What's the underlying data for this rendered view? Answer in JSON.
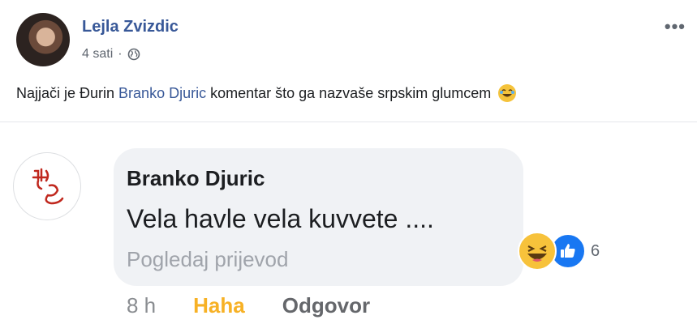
{
  "post": {
    "author": "Lejla Zvizdic",
    "time": "4 sati",
    "text_before": "Najjači je Đurin ",
    "tagged_user": "Branko Djuric",
    "text_after": " komentar što ga nazvaše srpskim glumcem",
    "more_label": "•••"
  },
  "comment": {
    "author": "Branko Djuric",
    "text": "Vela havle vela kuvvete ....",
    "translate_label": "Pogledaj prijevod",
    "reaction_count": "6",
    "time": "8 h",
    "haha_label": "Haha",
    "reply_label": "Odgovor"
  },
  "colors": {
    "link": "#385898",
    "haha": "#f7b125",
    "like": "#1877f2"
  }
}
